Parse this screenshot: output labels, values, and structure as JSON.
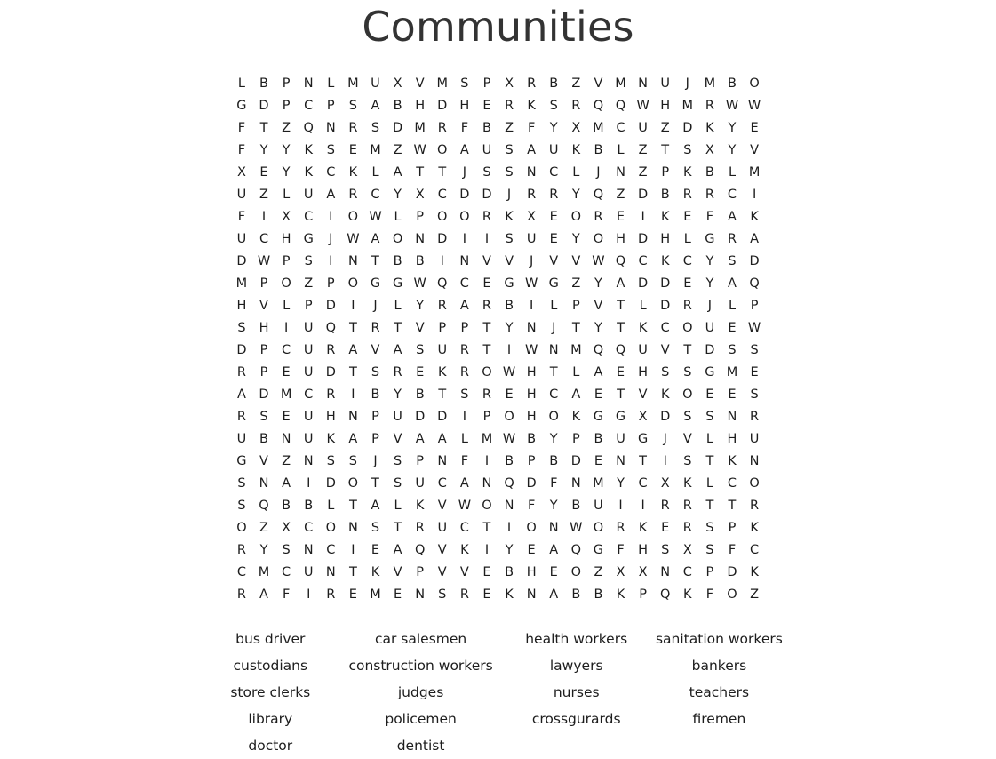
{
  "puzzle": {
    "title": "Communities",
    "grid_columns": 24,
    "grid_rows": 24,
    "grid": [
      [
        "L",
        "B",
        "P",
        "N",
        "L",
        "M",
        "U",
        "X",
        "V",
        "M",
        "S",
        "P",
        "X",
        "R",
        "B",
        "Z",
        "V",
        "M",
        "N",
        "U",
        "J",
        "M",
        "B",
        "O"
      ],
      [
        "G",
        "D",
        "P",
        "C",
        "P",
        "S",
        "A",
        "B",
        "H",
        "D",
        "H",
        "E",
        "R",
        "K",
        "S",
        "R",
        "Q",
        "Q",
        "W",
        "H",
        "M",
        "R",
        "W",
        "W"
      ],
      [
        "F",
        "T",
        "Z",
        "Q",
        "N",
        "R",
        "S",
        "D",
        "M",
        "R",
        "F",
        "B",
        "Z",
        "F",
        "Y",
        "X",
        "M",
        "C",
        "U",
        "Z",
        "D",
        "K",
        "Y",
        "E"
      ],
      [
        "F",
        "Y",
        "Y",
        "K",
        "S",
        "E",
        "M",
        "Z",
        "W",
        "O",
        "A",
        "U",
        "S",
        "A",
        "U",
        "K",
        "B",
        "L",
        "Z",
        "T",
        "S",
        "X",
        "Y",
        "V"
      ],
      [
        "X",
        "E",
        "Y",
        "K",
        "C",
        "K",
        "L",
        "A",
        "T",
        "T",
        "J",
        "S",
        "S",
        "N",
        "C",
        "L",
        "J",
        "N",
        "Z",
        "P",
        "K",
        "B",
        "L",
        "M"
      ],
      [
        "U",
        "Z",
        "L",
        "U",
        "A",
        "R",
        "C",
        "Y",
        "X",
        "C",
        "D",
        "D",
        "J",
        "R",
        "R",
        "Y",
        "Q",
        "Z",
        "D",
        "B",
        "R",
        "R",
        "C",
        "I"
      ],
      [
        "F",
        "I",
        "X",
        "C",
        "I",
        "O",
        "W",
        "L",
        "P",
        "O",
        "O",
        "R",
        "K",
        "X",
        "E",
        "O",
        "R",
        "E",
        "I",
        "K",
        "E",
        "F",
        "A",
        "K"
      ],
      [
        "U",
        "C",
        "H",
        "G",
        "J",
        "W",
        "A",
        "O",
        "N",
        "D",
        "I",
        "I",
        "S",
        "U",
        "E",
        "Y",
        "O",
        "H",
        "D",
        "H",
        "L",
        "G",
        "R",
        "A"
      ],
      [
        "D",
        "W",
        "P",
        "S",
        "I",
        "N",
        "T",
        "B",
        "B",
        "I",
        "N",
        "V",
        "V",
        "J",
        "V",
        "V",
        "W",
        "Q",
        "C",
        "K",
        "C",
        "Y",
        "S",
        "D"
      ],
      [
        "M",
        "P",
        "O",
        "Z",
        "P",
        "O",
        "G",
        "G",
        "W",
        "Q",
        "C",
        "E",
        "G",
        "W",
        "G",
        "Z",
        "Y",
        "A",
        "D",
        "D",
        "E",
        "Y",
        "A",
        "Q"
      ],
      [
        "H",
        "V",
        "L",
        "P",
        "D",
        "I",
        "J",
        "L",
        "Y",
        "R",
        "A",
        "R",
        "B",
        "I",
        "L",
        "P",
        "V",
        "T",
        "L",
        "D",
        "R",
        "J",
        "L",
        "P"
      ],
      [
        "S",
        "H",
        "I",
        "U",
        "Q",
        "T",
        "R",
        "T",
        "V",
        "P",
        "P",
        "T",
        "Y",
        "N",
        "J",
        "T",
        "Y",
        "T",
        "K",
        "C",
        "O",
        "U",
        "E",
        "W"
      ],
      [
        "D",
        "P",
        "C",
        "U",
        "R",
        "A",
        "V",
        "A",
        "S",
        "U",
        "R",
        "T",
        "I",
        "W",
        "N",
        "M",
        "Q",
        "Q",
        "U",
        "V",
        "T",
        "D",
        "S",
        "S"
      ],
      [
        "R",
        "P",
        "E",
        "U",
        "D",
        "T",
        "S",
        "R",
        "E",
        "K",
        "R",
        "O",
        "W",
        "H",
        "T",
        "L",
        "A",
        "E",
        "H",
        "S",
        "S",
        "G",
        "M",
        "E"
      ],
      [
        "A",
        "D",
        "M",
        "C",
        "R",
        "I",
        "B",
        "Y",
        "B",
        "T",
        "S",
        "R",
        "E",
        "H",
        "C",
        "A",
        "E",
        "T",
        "V",
        "K",
        "O",
        "E",
        "E",
        "S"
      ],
      [
        "R",
        "S",
        "E",
        "U",
        "H",
        "N",
        "P",
        "U",
        "D",
        "D",
        "I",
        "P",
        "O",
        "H",
        "O",
        "K",
        "G",
        "G",
        "X",
        "D",
        "S",
        "S",
        "N",
        "R"
      ],
      [
        "U",
        "B",
        "N",
        "U",
        "K",
        "A",
        "P",
        "V",
        "A",
        "A",
        "L",
        "M",
        "W",
        "B",
        "Y",
        "P",
        "B",
        "U",
        "G",
        "J",
        "V",
        "L",
        "H",
        "U"
      ],
      [
        "G",
        "V",
        "Z",
        "N",
        "S",
        "S",
        "J",
        "S",
        "P",
        "N",
        "F",
        "I",
        "B",
        "P",
        "B",
        "D",
        "E",
        "N",
        "T",
        "I",
        "S",
        "T",
        "K",
        "N"
      ],
      [
        "S",
        "N",
        "A",
        "I",
        "D",
        "O",
        "T",
        "S",
        "U",
        "C",
        "A",
        "N",
        "Q",
        "D",
        "F",
        "N",
        "M",
        "Y",
        "C",
        "X",
        "K",
        "L",
        "C",
        "O"
      ],
      [
        "S",
        "Q",
        "B",
        "B",
        "L",
        "T",
        "A",
        "L",
        "K",
        "V",
        "W",
        "O",
        "N",
        "F",
        "Y",
        "B",
        "U",
        "I",
        "I",
        "R",
        "R",
        "T",
        "T",
        "R"
      ],
      [
        "O",
        "Z",
        "X",
        "C",
        "O",
        "N",
        "S",
        "T",
        "R",
        "U",
        "C",
        "T",
        "I",
        "O",
        "N",
        "W",
        "O",
        "R",
        "K",
        "E",
        "R",
        "S",
        "P",
        "K"
      ],
      [
        "R",
        "Y",
        "S",
        "N",
        "C",
        "I",
        "E",
        "A",
        "Q",
        "V",
        "K",
        "I",
        "Y",
        "E",
        "A",
        "Q",
        "G",
        "F",
        "H",
        "S",
        "X",
        "S",
        "F",
        "C"
      ],
      [
        "C",
        "M",
        "C",
        "U",
        "N",
        "T",
        "K",
        "V",
        "P",
        "V",
        "V",
        "E",
        "B",
        "H",
        "E",
        "O",
        "Z",
        "X",
        "X",
        "N",
        "C",
        "P",
        "D",
        "K"
      ],
      [
        "R",
        "A",
        "F",
        "I",
        "R",
        "E",
        "M",
        "E",
        "N",
        "S",
        "R",
        "E",
        "K",
        "N",
        "A",
        "B",
        "B",
        "K",
        "P",
        "Q",
        "K",
        "F",
        "O",
        "Z"
      ]
    ],
    "word_list_rows": [
      [
        "bus driver",
        "car salesmen",
        "health workers",
        "sanitation workers"
      ],
      [
        "custodians",
        "construction workers",
        "lawyers",
        "bankers"
      ],
      [
        "store clerks",
        "judges",
        "nurses",
        "teachers"
      ],
      [
        "library",
        "policemen",
        "crossgurards",
        "firemen"
      ],
      [
        "doctor",
        "dentist",
        "",
        ""
      ]
    ],
    "words": [
      "bus driver",
      "car salesmen",
      "health workers",
      "sanitation workers",
      "custodians",
      "construction workers",
      "lawyers",
      "bankers",
      "store clerks",
      "judges",
      "nurses",
      "teachers",
      "library",
      "policemen",
      "crossgurards",
      "firemen",
      "doctor",
      "dentist"
    ],
    "colors": {
      "page_background": "#ffffff",
      "title_text": "#333333",
      "letter_text": "#1d1d1d",
      "word_text": "#1d1d1d"
    }
  }
}
